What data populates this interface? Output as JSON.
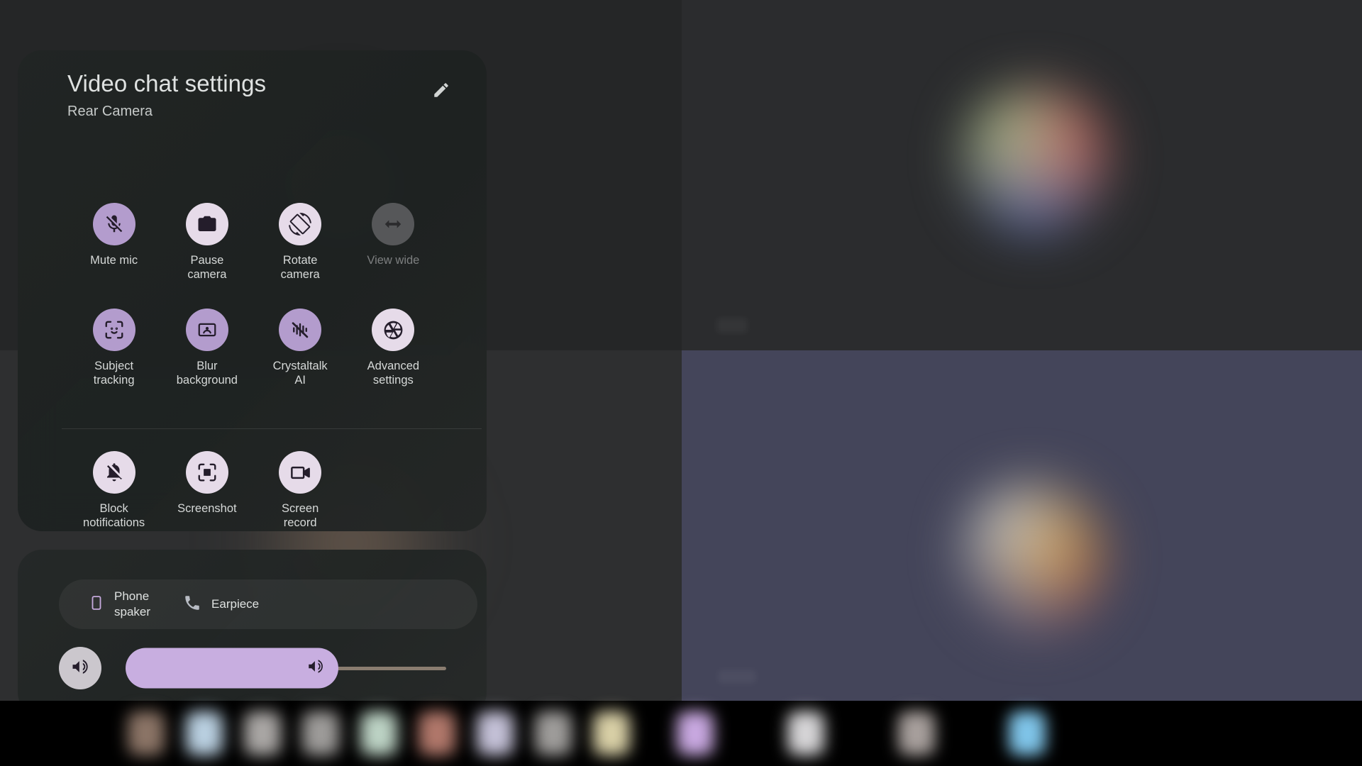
{
  "panel": {
    "title": "Video chat settings",
    "subtitle": "Rear Camera",
    "edit_icon": "pencil-icon",
    "accent_active": "#b39ccd",
    "accent_idle": "#e6dbe9",
    "accent_disabled": "#565759",
    "surface": "#1f2322"
  },
  "tiles": [
    {
      "label": "Mute mic",
      "icon": "mic-off-icon",
      "state": "active",
      "row": 1
    },
    {
      "label": "Pause\ncamera",
      "icon": "camera-lock-icon",
      "state": "idle",
      "row": 1
    },
    {
      "label": "Rotate\ncamera",
      "icon": "screen-rotation-icon",
      "state": "idle",
      "row": 1
    },
    {
      "label": "View wide",
      "icon": "arrows-horizontal-icon",
      "state": "disabled",
      "row": 1
    },
    {
      "label": "Subject\ntracking",
      "icon": "face-tracking-icon",
      "state": "active",
      "row": 2
    },
    {
      "label": "Blur\nbackground",
      "icon": "portrait-blur-icon",
      "state": "active",
      "row": 2
    },
    {
      "label": "Crystaltalk\nAI",
      "icon": "voice-waves-off-icon",
      "state": "active",
      "row": 2
    },
    {
      "label": "Advanced\nsettings",
      "icon": "aperture-icon",
      "state": "idle",
      "row": 2
    },
    {
      "label": "Block\nnotifications",
      "icon": "bell-off-icon",
      "state": "idle",
      "row": 3
    },
    {
      "label": "Screenshot",
      "icon": "screenshot-icon",
      "state": "idle",
      "row": 3
    },
    {
      "label": "Screen\nrecord",
      "icon": "video-camera-icon",
      "state": "idle",
      "row": 3
    }
  ],
  "audio": {
    "outputs": [
      {
        "label": "Phone\nspaker",
        "icon": "phone-device-icon",
        "selected": true
      },
      {
        "label": "Earpiece",
        "icon": "phone-handset-icon",
        "selected": false
      }
    ],
    "volume": {
      "button_icon": "volume-up-icon",
      "thumb_icon": "volume-up-icon",
      "percent": 66
    }
  },
  "taskbar": {
    "icon_colors": [
      "#8b7466",
      "#b9cfe0",
      "#a9a6a4",
      "#9d9b99",
      "#bcd2c4",
      "#b0776a",
      "#c3c0d6",
      "#9e9c9a",
      "#d8cfa6",
      "#c8a8e0",
      "#d5d4d6",
      "#a79f9c",
      "#7fc4e8"
    ]
  }
}
